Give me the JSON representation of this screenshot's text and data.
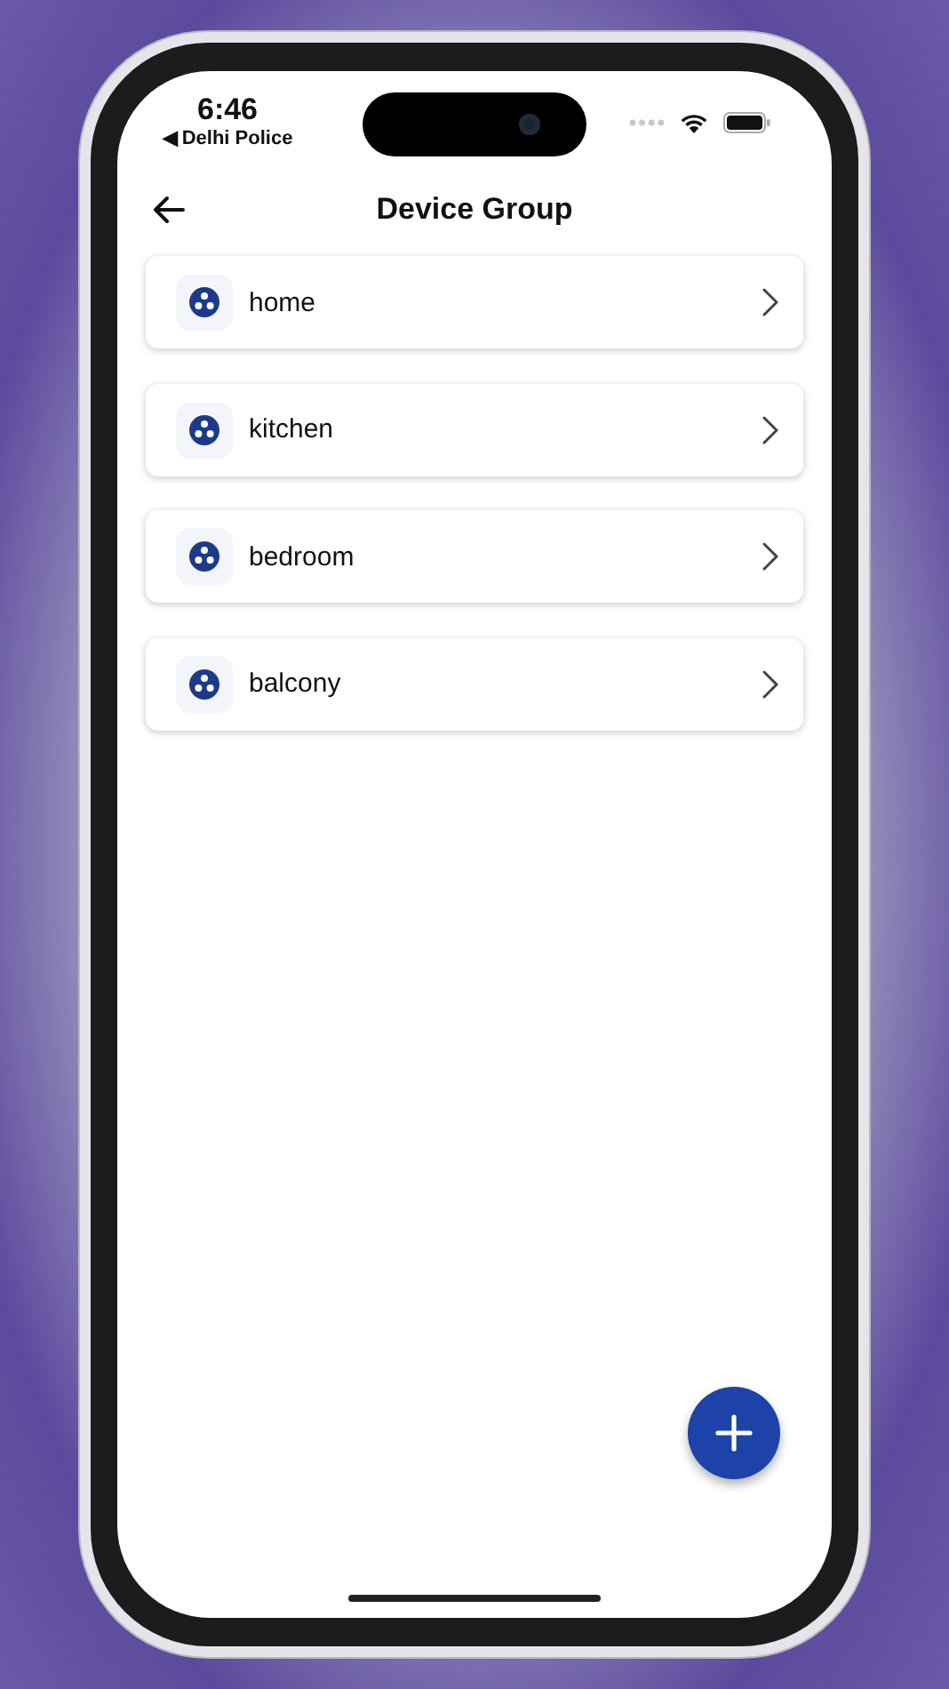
{
  "status_bar": {
    "time": "6:46",
    "back_app": "◀ Delhi Police"
  },
  "header": {
    "title": "Device Group"
  },
  "groups": [
    {
      "name": "home"
    },
    {
      "name": "kitchen"
    },
    {
      "name": "bedroom"
    },
    {
      "name": "balcony"
    }
  ]
}
